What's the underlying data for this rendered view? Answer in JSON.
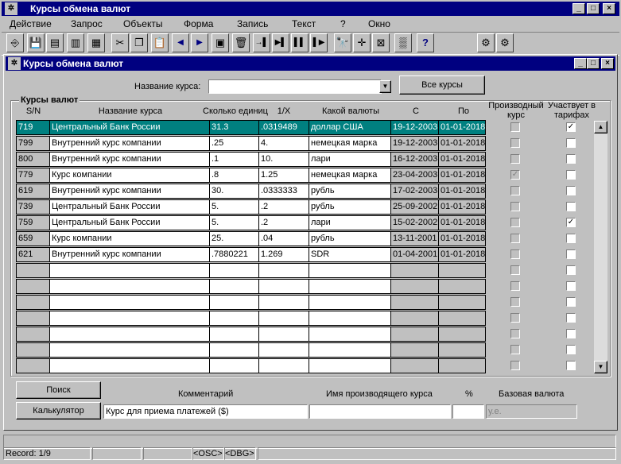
{
  "app": {
    "title": "Курсы обмена валют"
  },
  "menu": [
    "Действие",
    "Запрос",
    "Объекты",
    "Форма",
    "Запись",
    "Текст",
    "?",
    "Окно"
  ],
  "toolbar": [
    {
      "name": "exit-icon",
      "glyph": "⎆"
    },
    {
      "name": "save-icon",
      "glyph": "💾"
    },
    {
      "name": "enter-query-icon",
      "glyph": "▤"
    },
    {
      "name": "execute-query-icon",
      "glyph": "▥"
    },
    {
      "name": "cancel-query-icon",
      "glyph": "▦"
    },
    {
      "name": "cut-icon",
      "glyph": "✂"
    },
    {
      "name": "copy-icon",
      "glyph": "❐"
    },
    {
      "name": "paste-icon",
      "glyph": "📋"
    },
    {
      "name": "prev-block-icon",
      "glyph": "◀"
    },
    {
      "name": "next-block-icon",
      "glyph": "▶"
    },
    {
      "name": "clear-icon",
      "glyph": "▣"
    },
    {
      "name": "delete-icon",
      "glyph": "🗑"
    },
    {
      "name": "insert-record-icon",
      "glyph": "→▌"
    },
    {
      "name": "duplicate-record-icon",
      "glyph": "▶▌"
    },
    {
      "name": "lock-record-icon",
      "glyph": "▌▌"
    },
    {
      "name": "remove-record-icon",
      "glyph": "▌▶"
    },
    {
      "name": "find-icon",
      "glyph": "🔭"
    },
    {
      "name": "arrow-cross-icon",
      "glyph": "✛"
    },
    {
      "name": "edit-field-icon",
      "glyph": "⊠"
    },
    {
      "name": "list-icon",
      "glyph": "▒"
    },
    {
      "name": "help-icon",
      "glyph": "?"
    },
    {
      "name": "gears-icon",
      "glyph": "⚙"
    },
    {
      "name": "gears-settings-icon",
      "glyph": "⚙"
    }
  ],
  "form": {
    "title": "Курсы обмена валют",
    "rate_name_label": "Название курса:",
    "rate_name_value": "",
    "all_rates_button": "Все курсы",
    "group_label": "Курсы валют",
    "headers": {
      "sn": "S/N",
      "name": "Название курса",
      "units": "Сколько единиц",
      "inverse": "1/X",
      "currency": "Какой валюты",
      "from": "С",
      "to": "По",
      "derived": "Производный курс",
      "tariffs": "Участвует в тарифах"
    },
    "rows": [
      {
        "sn": "719",
        "name": "Центральный Банк России",
        "units": "31.3",
        "inverse": ".0319489",
        "currency": "доллар США",
        "from": "19-12-2003",
        "to": "01-01-2018",
        "derived": false,
        "derived_disabled": false,
        "tariffs": true,
        "selected": true
      },
      {
        "sn": "799",
        "name": "Внутренний курс компании",
        "units": ".25",
        "inverse": "4.",
        "currency": "немецкая марка",
        "from": "19-12-2003",
        "to": "01-01-2018",
        "derived": false,
        "derived_disabled": false,
        "tariffs": false,
        "selected": false
      },
      {
        "sn": "800",
        "name": "Внутренний курс компании",
        "units": ".1",
        "inverse": "10.",
        "currency": "лари",
        "from": "16-12-2003",
        "to": "01-01-2018",
        "derived": false,
        "derived_disabled": false,
        "tariffs": false,
        "selected": false
      },
      {
        "sn": "779",
        "name": "Курс компании",
        "units": ".8",
        "inverse": "1.25",
        "currency": "немецкая марка",
        "from": "23-04-2003",
        "to": "01-01-2018",
        "derived": true,
        "derived_disabled": true,
        "tariffs": false,
        "selected": false
      },
      {
        "sn": "619",
        "name": "Внутренний курс компании",
        "units": "30.",
        "inverse": ".0333333",
        "currency": "рубль",
        "from": "17-02-2003",
        "to": "01-01-2018",
        "derived": false,
        "derived_disabled": false,
        "tariffs": false,
        "selected": false
      },
      {
        "sn": "739",
        "name": "Центральный Банк России",
        "units": "5.",
        "inverse": ".2",
        "currency": "рубль",
        "from": "25-09-2002",
        "to": "01-01-2018",
        "derived": false,
        "derived_disabled": false,
        "tariffs": false,
        "selected": false
      },
      {
        "sn": "759",
        "name": "Центральный Банк России",
        "units": "5.",
        "inverse": ".2",
        "currency": "лари",
        "from": "15-02-2002",
        "to": "01-01-2018",
        "derived": false,
        "derived_disabled": false,
        "tariffs": true,
        "selected": false
      },
      {
        "sn": "659",
        "name": "Курс компании",
        "units": "25.",
        "inverse": ".04",
        "currency": "рубль",
        "from": "13-11-2001",
        "to": "01-01-2018",
        "derived": false,
        "derived_disabled": false,
        "tariffs": false,
        "selected": false
      },
      {
        "sn": "621",
        "name": "Внутренний курс компании",
        "units": ".7880221",
        "inverse": "1.269",
        "currency": "SDR",
        "from": "01-04-2001",
        "to": "01-01-2018",
        "derived": false,
        "derived_disabled": false,
        "tariffs": false,
        "selected": false
      }
    ],
    "total_rows": 16,
    "search_button": "Поиск",
    "calculator_button": "Калькулятор",
    "comment_label": "Комментарий",
    "comment_value": "Курс для приема платежей ($)",
    "derived_name_label": "Имя производящего курса",
    "derived_name_value": "",
    "percent_label": "%",
    "percent_value": "",
    "base_currency_label": "Базовая валюта",
    "base_currency_value": "у.е."
  },
  "status": {
    "record": "Record: 1/9",
    "osc": "<OSC>",
    "dbg": "<DBG>"
  },
  "colors": {
    "selected_row": "#008080",
    "titlebar": "#000080"
  }
}
